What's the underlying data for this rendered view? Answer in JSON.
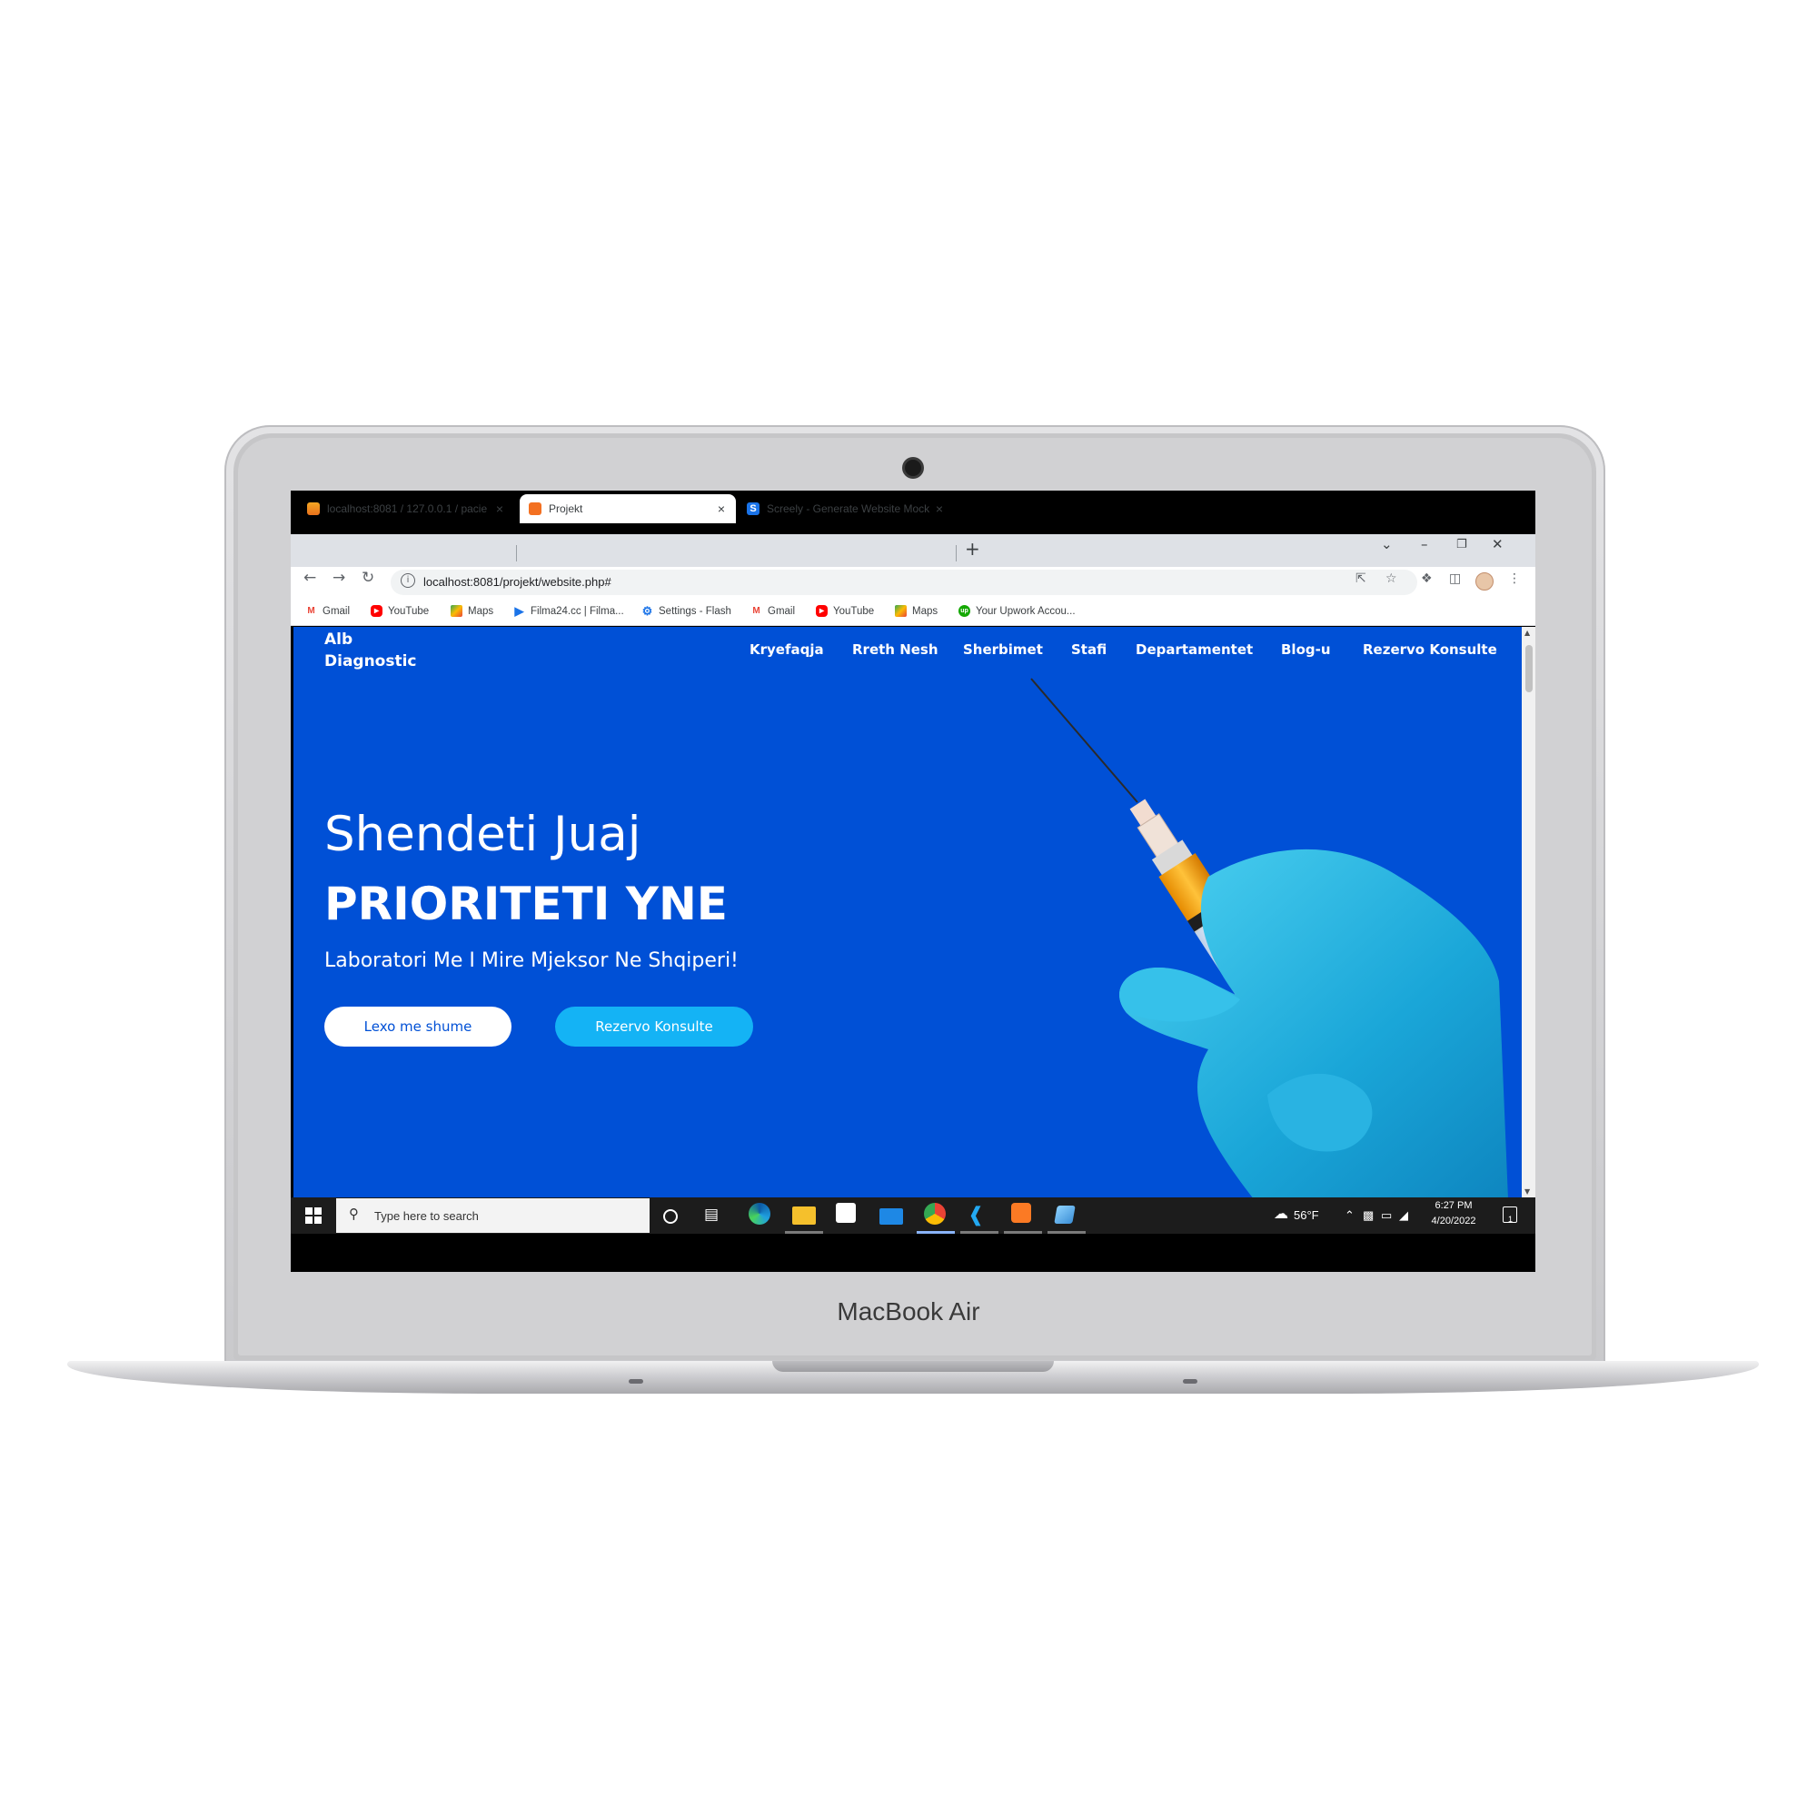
{
  "device": {
    "label": "MacBook Air"
  },
  "browser": {
    "tabs": [
      {
        "title": "localhost:8081 / 127.0.0.1 / pacie",
        "close": "×"
      },
      {
        "title": "Projekt",
        "close": "×"
      },
      {
        "title": "Screely - Generate Website Mock",
        "close": "×"
      }
    ],
    "new_tab": "+",
    "url": "localhost:8081/projekt/website.php#",
    "bookmarks": [
      {
        "label": "Gmail",
        "color": "#ea4335",
        "icon": "gmail-icon"
      },
      {
        "label": "YouTube",
        "color": "#ff0000",
        "icon": "youtube-icon"
      },
      {
        "label": "Maps",
        "color": "#34a853",
        "icon": "maps-icon"
      },
      {
        "label": "Filma24.cc | Filma...",
        "color": "#1a73e8",
        "icon": "play-icon"
      },
      {
        "label": "Settings - Flash",
        "color": "#1a73e8",
        "icon": "settings-icon"
      },
      {
        "label": "Gmail",
        "color": "#ea4335",
        "icon": "gmail-icon"
      },
      {
        "label": "YouTube",
        "color": "#ff0000",
        "icon": "youtube-icon"
      },
      {
        "label": "Maps",
        "color": "#34a853",
        "icon": "maps-icon"
      },
      {
        "label": "Your Upwork Accou...",
        "color": "#14a800",
        "icon": "upwork-icon"
      }
    ]
  },
  "site": {
    "brand_color": "#0050d6",
    "logo_line1": "Alb",
    "logo_line2": "Diagnostic",
    "nav": [
      "Kryefaqja",
      "Rreth Nesh",
      "Sherbimet",
      "Stafi",
      "Departamentet",
      "Blog-u",
      "Rezervo Konsulte"
    ],
    "hero": {
      "title_light": "Shendeti Juaj",
      "title_bold": "PRIORITETI YNE",
      "subtitle": "Laboratori Me I Mire Mjeksor Ne Shqiperi!",
      "primary_button": "Lexo me shume",
      "secondary_button": "Rezervo Konsulte",
      "accent_color": "#14b3f5"
    }
  },
  "taskbar": {
    "search_placeholder": "Type here to search",
    "temperature": "56°F",
    "time": "6:27 PM",
    "date": "4/20/2022",
    "notification_count": "1"
  }
}
